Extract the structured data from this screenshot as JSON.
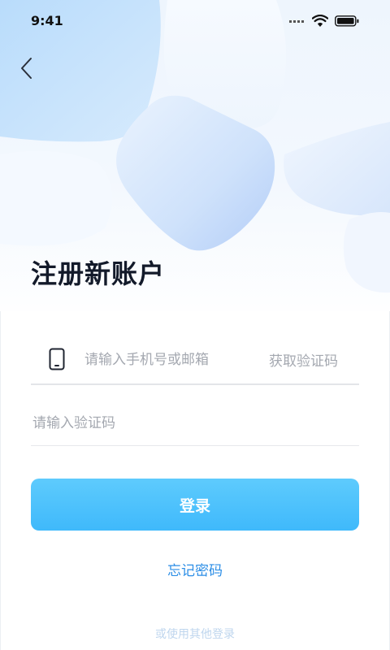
{
  "status_bar": {
    "time": "9:41",
    "icons": [
      "signal-icon",
      "wifi-icon",
      "battery-icon"
    ]
  },
  "header": {
    "back_icon": "chevron-left-icon",
    "title": "注册新账户"
  },
  "form": {
    "phone": {
      "icon": "phone-icon",
      "placeholder": "请输入手机号或邮箱",
      "value": ""
    },
    "get_code_label": "获取验证码",
    "code": {
      "placeholder": "请输入验证码",
      "value": ""
    }
  },
  "actions": {
    "login_label": "登录",
    "forgot_label": "忘记密码",
    "other_login_label": "或使用其他登录"
  },
  "colors": {
    "accent_button": "#4ac0fc",
    "link": "#2c8ee6",
    "title": "#131a2a",
    "placeholder": "#a4a8b0"
  }
}
